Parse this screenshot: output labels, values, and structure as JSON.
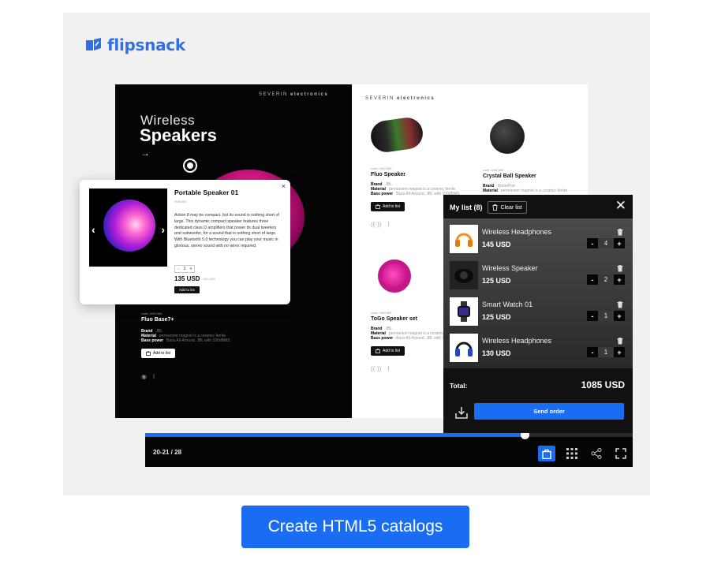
{
  "brand": {
    "name": "flipsnack"
  },
  "catalog": {
    "brand_prefix": "SEVERIN",
    "brand_suffix": "electronics",
    "hero_line1": "Wireless",
    "hero_line2": "Speakers",
    "hero_arrow": "→",
    "left_product": {
      "code": "code: 0987465",
      "name": "Fluo Base7+",
      "specs": [
        {
          "label": "Brand",
          "value": "JBL"
        },
        {
          "label": "Material",
          "value": "permanent magnet is a ceramic ferrite"
        },
        {
          "label": "Bass power",
          "value": "Bass All-Around, JBL with 100dBMS"
        }
      ],
      "add_label": "Add to list"
    },
    "right_products": [
      {
        "code": "code: 0987465",
        "name": "Fluo Speaker",
        "specs": [
          {
            "label": "Brand",
            "value": "JBL"
          },
          {
            "label": "Material",
            "value": "permanent magnet is a ceramic ferrite"
          },
          {
            "label": "Bass power",
            "value": "Bass All-Around, JBL with 100dBMS"
          }
        ],
        "add_label": "Add to list"
      },
      {
        "code": "code: 0987465",
        "name": "Crystal Ball Speaker",
        "specs": [
          {
            "label": "Brand",
            "value": "HomePod"
          },
          {
            "label": "Material",
            "value": "permanent magnet is a ceramic ferrite"
          },
          {
            "label": "Bass power",
            "value": "Bass All-Around"
          }
        ],
        "add_label": "Add to list"
      },
      {
        "code": "code: 0987465",
        "name": "ToGo Speaker set",
        "specs": [
          {
            "label": "Brand",
            "value": "JBL"
          },
          {
            "label": "Material",
            "value": "permanent magnet is a ceramic ferrite"
          },
          {
            "label": "Bass power",
            "value": "Bass All-Around, JBL with 100dBMS"
          }
        ],
        "add_label": "Add to list"
      }
    ]
  },
  "popup": {
    "title": "Portable Speaker 01",
    "code": "9080480",
    "description": "Action 8 may be compact, but its sound is nothing short of large. This dynamic compact speaker features three dedicated class D amplifiers that power its dual tweeters and subwoofer, for a sound that is nothing short of large. With Bluetooth 5.0 technology you can play your music in glorious, stereo sound with no wires required.",
    "qty": "1",
    "price": "135 USD",
    "old_price": "150 USD",
    "add_label": "Add to list",
    "close": "×",
    "prev": "‹",
    "next": "›"
  },
  "cart": {
    "title": "My list (8)",
    "clear_label": "Clear list",
    "close": "✕",
    "items": [
      {
        "name": "Wireless Headphones",
        "price": "145 USD",
        "qty": "4",
        "icon": "headphones-orange"
      },
      {
        "name": "Wireless Speaker",
        "price": "125 USD",
        "qty": "2",
        "icon": "speaker-black"
      },
      {
        "name": "Smart Watch 01",
        "price": "125 USD",
        "qty": "1",
        "icon": "smart-watch"
      },
      {
        "name": "Wireless Headphones",
        "price": "130 USD",
        "qty": "1",
        "icon": "headphones-blue"
      }
    ],
    "minus": "-",
    "plus": "+",
    "total_label": "Total:",
    "total_value": "1085 USD",
    "send_label": "Send order"
  },
  "toolbar": {
    "page_indicator": "20-21 / 28",
    "progress": 0.779
  },
  "cta": {
    "label": "Create HTML5 catalogs"
  },
  "colors": {
    "accent": "#1a6cf2",
    "brand": "#2f6fe8",
    "dark": "#050505"
  }
}
